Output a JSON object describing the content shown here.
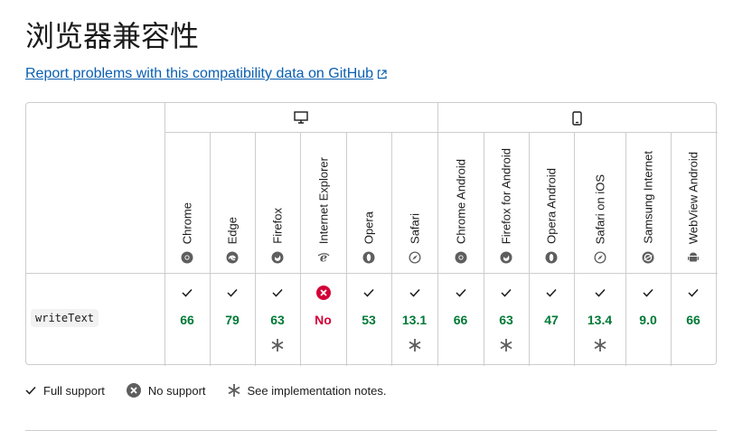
{
  "page": {
    "title": "浏览器兼容性",
    "report_link": "Report problems with this compatibility data on GitHub"
  },
  "platforms": [
    {
      "name": "desktop",
      "icon": "desktop-icon"
    },
    {
      "name": "mobile",
      "icon": "mobile-icon"
    }
  ],
  "feature": {
    "name": "writeText"
  },
  "browsers": [
    {
      "name": "Chrome",
      "logo": "chrome-logo",
      "support": "yes",
      "version": "66",
      "notes": false
    },
    {
      "name": "Edge",
      "logo": "edge-logo",
      "support": "yes",
      "version": "79",
      "notes": false
    },
    {
      "name": "Firefox",
      "logo": "firefox-logo",
      "support": "yes",
      "version": "63",
      "notes": true
    },
    {
      "name": "Internet Explorer",
      "logo": "ie-logo",
      "support": "no",
      "version": "No",
      "notes": false
    },
    {
      "name": "Opera",
      "logo": "opera-logo",
      "support": "yes",
      "version": "53",
      "notes": false
    },
    {
      "name": "Safari",
      "logo": "safari-logo",
      "support": "yes",
      "version": "13.1",
      "notes": true
    },
    {
      "name": "Chrome Android",
      "logo": "chrome-logo",
      "support": "yes",
      "version": "66",
      "notes": false
    },
    {
      "name": "Firefox for Android",
      "logo": "firefox-logo",
      "support": "yes",
      "version": "63",
      "notes": true
    },
    {
      "name": "Opera Android",
      "logo": "opera-logo",
      "support": "yes",
      "version": "47",
      "notes": false
    },
    {
      "name": "Safari on iOS",
      "logo": "safari-logo",
      "support": "yes",
      "version": "13.4",
      "notes": true
    },
    {
      "name": "Samsung Internet",
      "logo": "samsung-logo",
      "support": "yes",
      "version": "9.0",
      "notes": false
    },
    {
      "name": "WebView Android",
      "logo": "android-logo",
      "support": "yes",
      "version": "66",
      "notes": false
    }
  ],
  "legend": {
    "full_support": "Full support",
    "no_support": "No support",
    "notes": "See implementation notes."
  },
  "colors": {
    "supported": "#007936",
    "unsupported": "#d30038",
    "link": "#0b5fb0",
    "border": "#cdcdcd"
  }
}
